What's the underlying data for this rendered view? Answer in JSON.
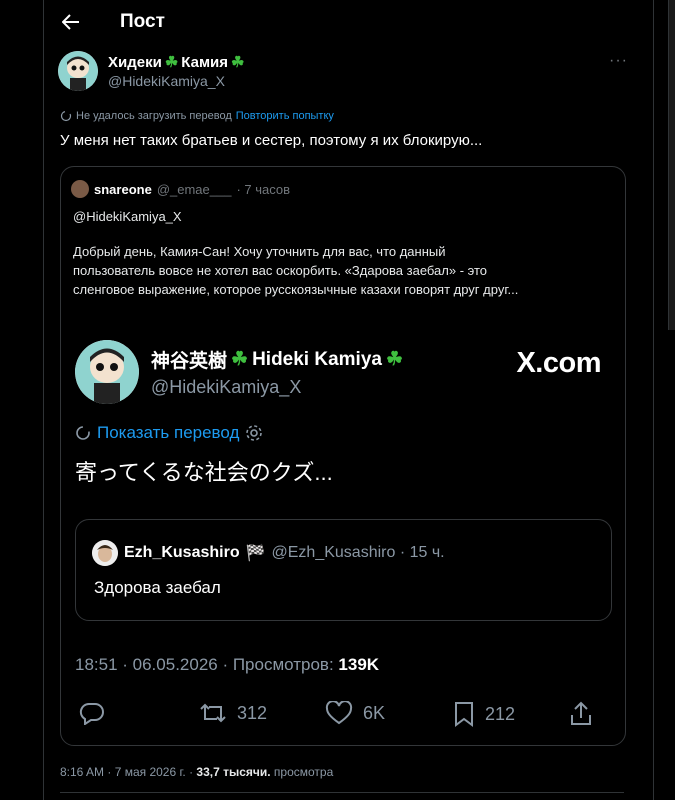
{
  "header": {
    "title": "Пост"
  },
  "post": {
    "author": {
      "display_name": "Хидеки",
      "name_suffix": "Камия"
    },
    "handle": "@HidekiKamiya_X",
    "translate_error": "Не удалось загрузить перевод",
    "retry_label": "Повторить попытку",
    "text": "У меня нет таких братьев и сестер, поэтому я их блокирую..."
  },
  "quote": {
    "author_name": "snareone",
    "author_handle": "@_emae___",
    "time": "· 7 часов",
    "mention": "@HidekiKamiya_X",
    "line1": "Добрый день, Камия-Сан! Хочу уточнить для вас, что данный",
    "line2": "пользователь вовсе не хотел вас оскорбить. «Здарова заебал» - это",
    "line3": "сленговое выражение, которое русскоязычные казахи говорят друг друг..."
  },
  "screenshot": {
    "jp_name": "神谷英樹",
    "en_name": "Hideki Kamiya",
    "handle": "@HidekiKamiya_X",
    "brand": "X.com",
    "show_translation": "Показать перевод",
    "text": "寄ってくるな社会のクズ...",
    "inner_author": "Ezh_Kusashiro",
    "inner_handle": "@Ezh_Kusashiro · 15 ч.",
    "inner_text": "Здорова заебал",
    "timestamp": "18:51 · 06.05.2026 · Просмотров:",
    "views": "139K",
    "reposts": "312",
    "likes": "6K",
    "bookmarks": "212"
  },
  "meta": {
    "time_date": "8:16 AM · 7 мая 2026 г. ·",
    "views_count": "33,7 тысячи.",
    "views_label": "просмотра"
  },
  "colors": {
    "accent": "#1d9bf0",
    "clover": "#3fbf3f",
    "muted": "#8b98a5"
  }
}
